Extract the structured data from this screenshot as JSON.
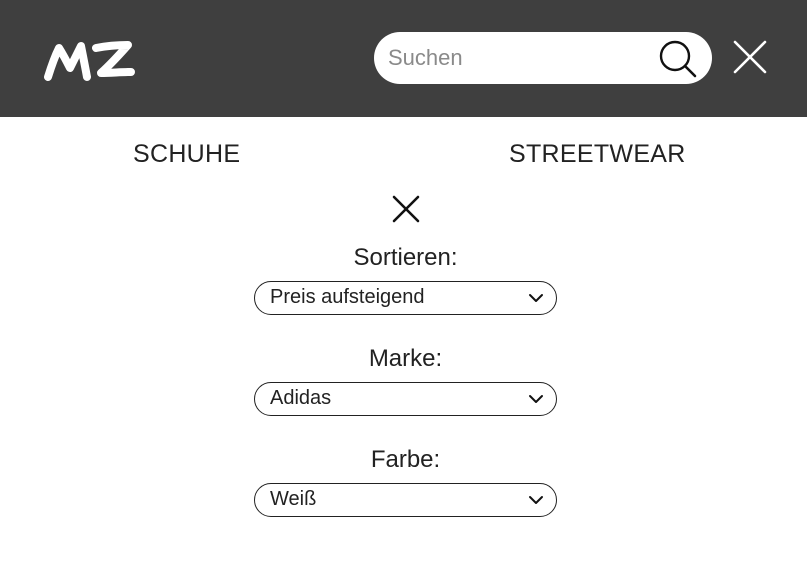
{
  "header": {
    "logo_text": "MZ",
    "search": {
      "placeholder": "Suchen",
      "value": ""
    }
  },
  "nav": {
    "items": [
      {
        "label": "SCHUHE"
      },
      {
        "label": "STREETWEAR"
      }
    ]
  },
  "filters": [
    {
      "label": "Sortieren:",
      "selected": "Preis aufsteigend"
    },
    {
      "label": "Marke:",
      "selected": "Adidas"
    },
    {
      "label": "Farbe:",
      "selected": "Weiß"
    }
  ],
  "colors": {
    "header_background": "#3f3f3f",
    "text": "#222222",
    "search_placeholder": "#8a8a8a"
  },
  "icons": [
    "logo",
    "search-icon",
    "close-icon",
    "chevron-down-icon"
  ]
}
